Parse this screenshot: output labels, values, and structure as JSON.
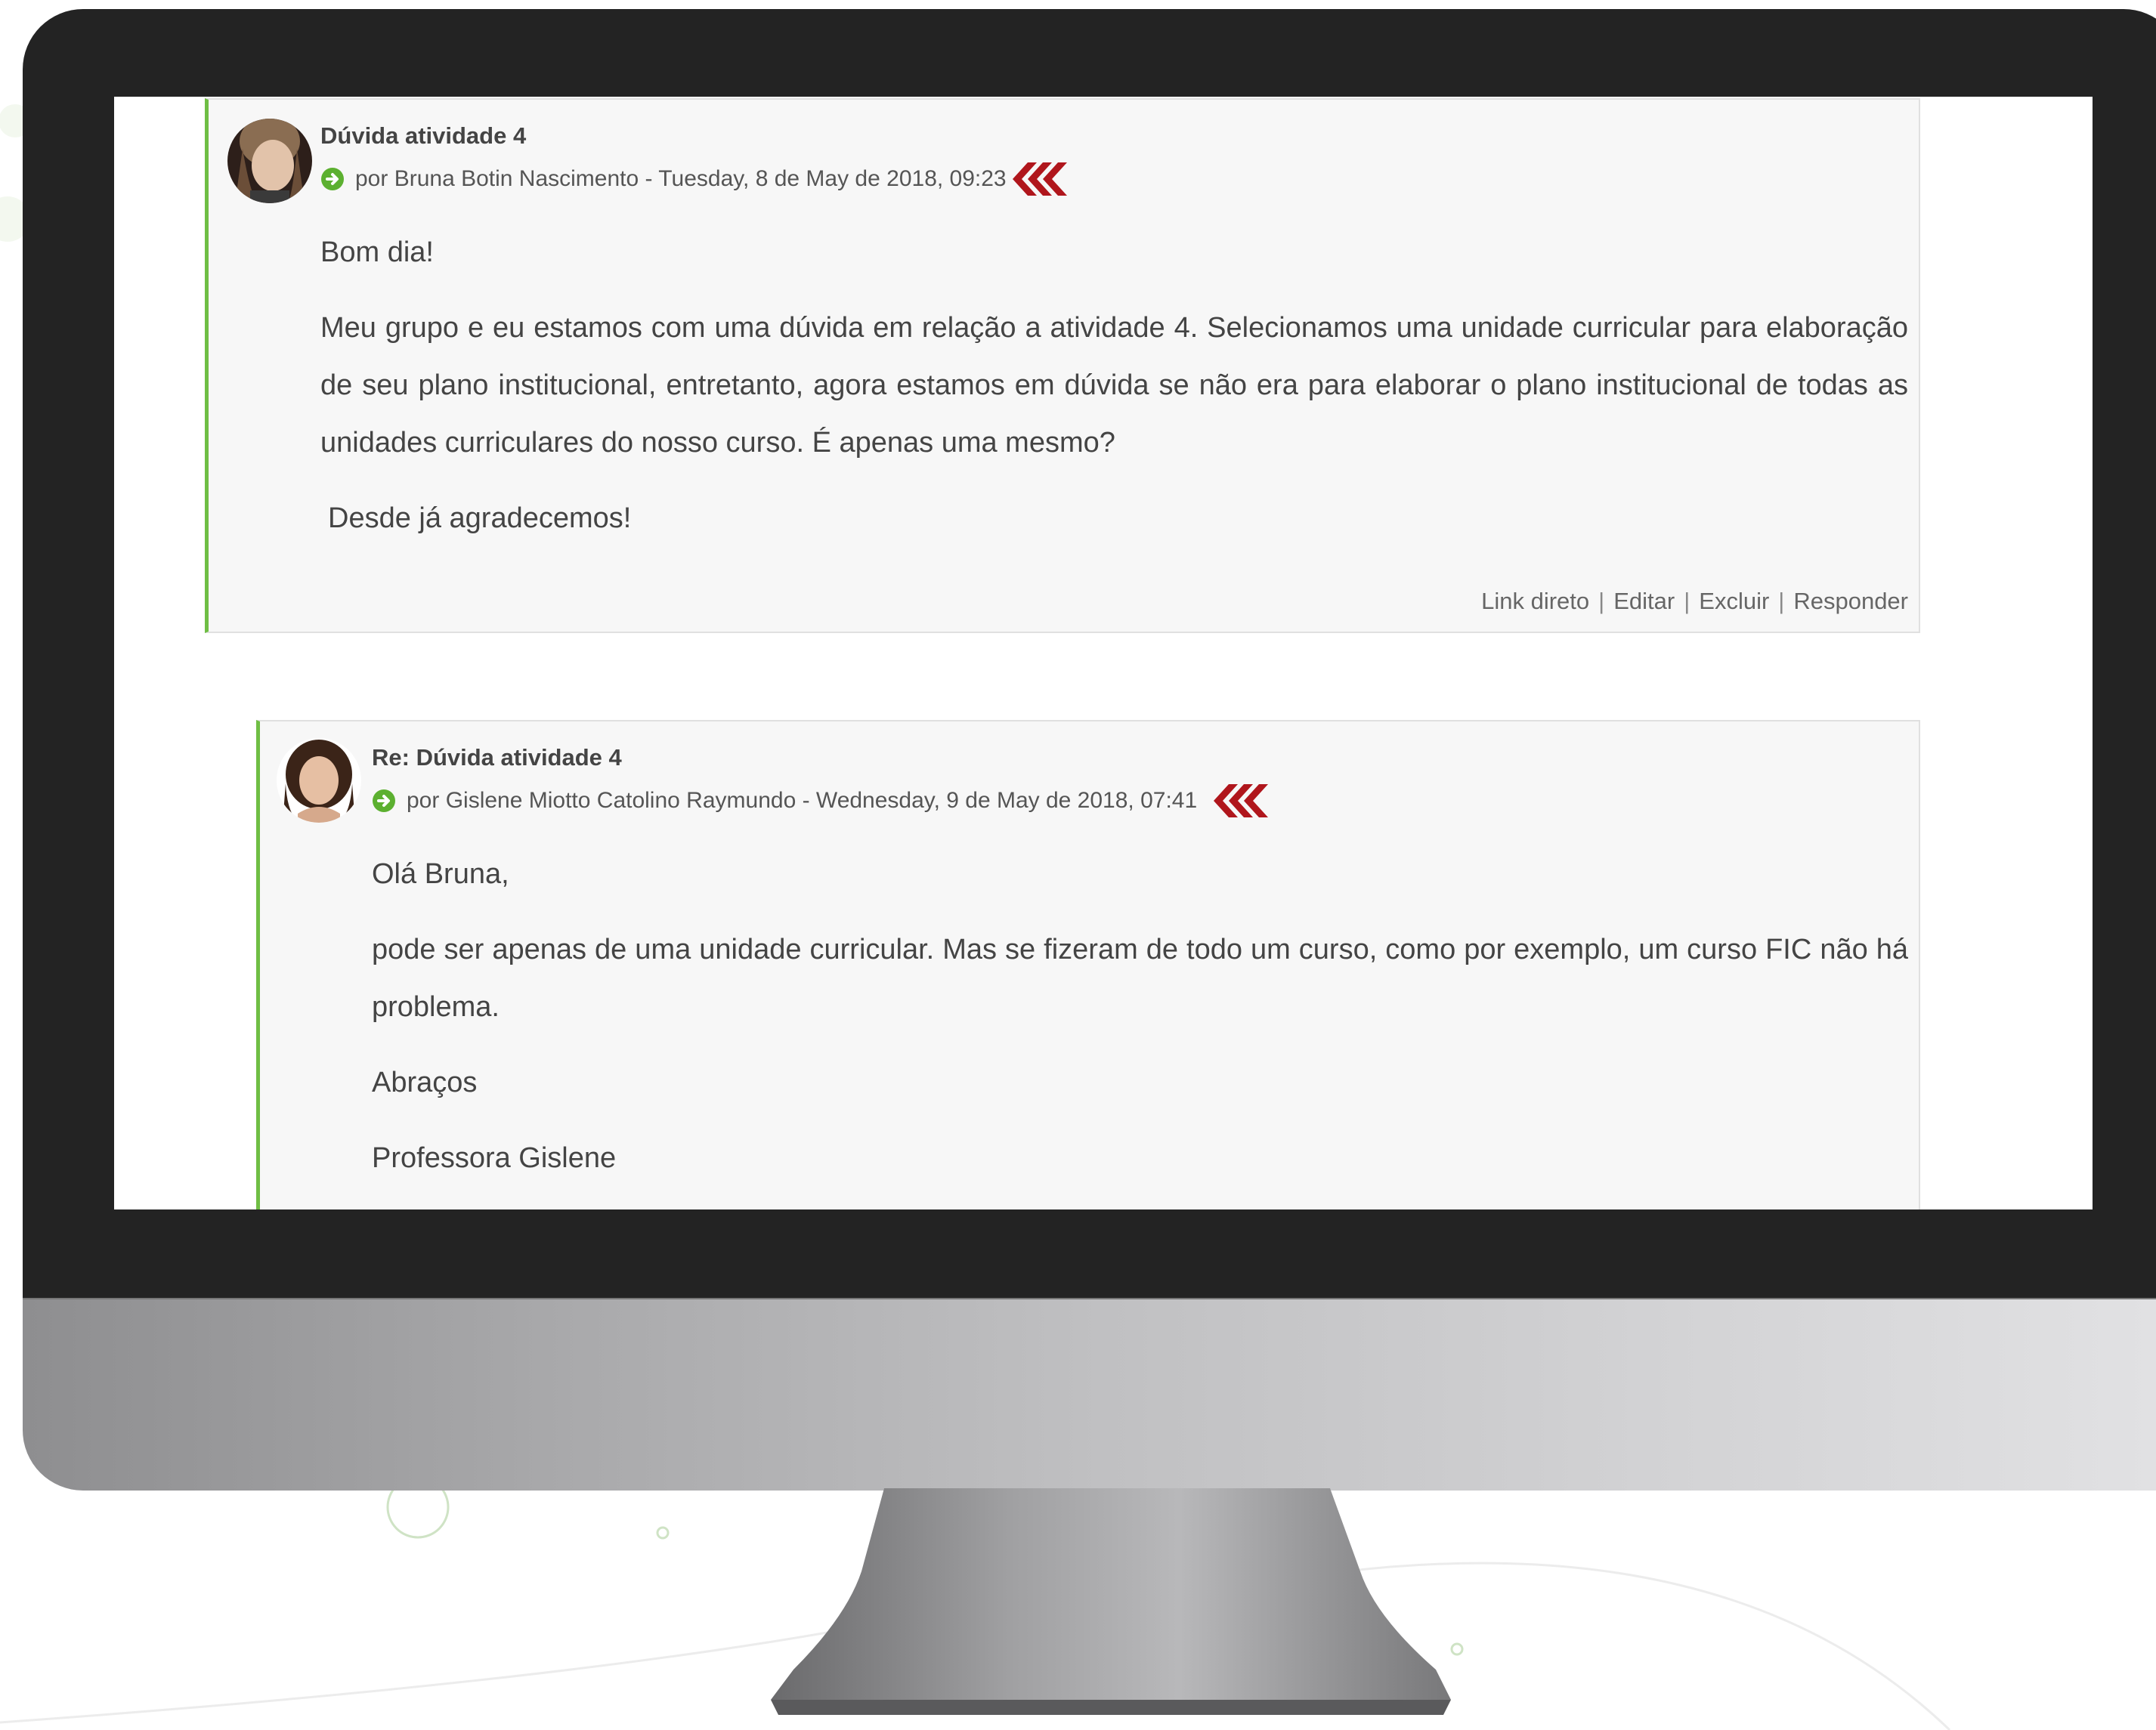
{
  "posts": [
    {
      "subject": "Dúvida atividade 4",
      "byline": "por Bruna Botin Nascimento - Tuesday, 8 de May de 2018, 09:23",
      "paragraphs": [
        "Bom dia!",
        "Meu grupo e eu estamos com uma dúvida em relação a atividade 4. Selecionamos uma unidade curricular para elaboração de seu plano institucional, entretanto, agora estamos em dúvida se não era para elaborar o plano institucional de todas as unidades curriculares do nosso curso. É apenas uma mesmo?",
        "Desde já agradecemos!"
      ],
      "commands": [
        "Link direto",
        "Editar",
        "Excluir",
        "Responder"
      ]
    },
    {
      "subject": "Re: Dúvida atividade 4",
      "byline": "por Gislene Miotto Catolino Raymundo - Wednesday, 9 de May de 2018, 07:41",
      "paragraphs": [
        "Olá Bruna,",
        "pode ser apenas de uma unidade curricular. Mas se fizeram de todo um curso, como por exemplo, um curso FIC não há problema.",
        "Abraços",
        "Professora Gislene"
      ]
    }
  ],
  "colors": {
    "accent_border": "#6fbe44",
    "chevron": "#b0161c",
    "post_bg": "#f7f7f7",
    "bezel": "#232323"
  },
  "icons": [
    "arrow-circle-icon",
    "chevrons-left-icon",
    "avatar"
  ]
}
